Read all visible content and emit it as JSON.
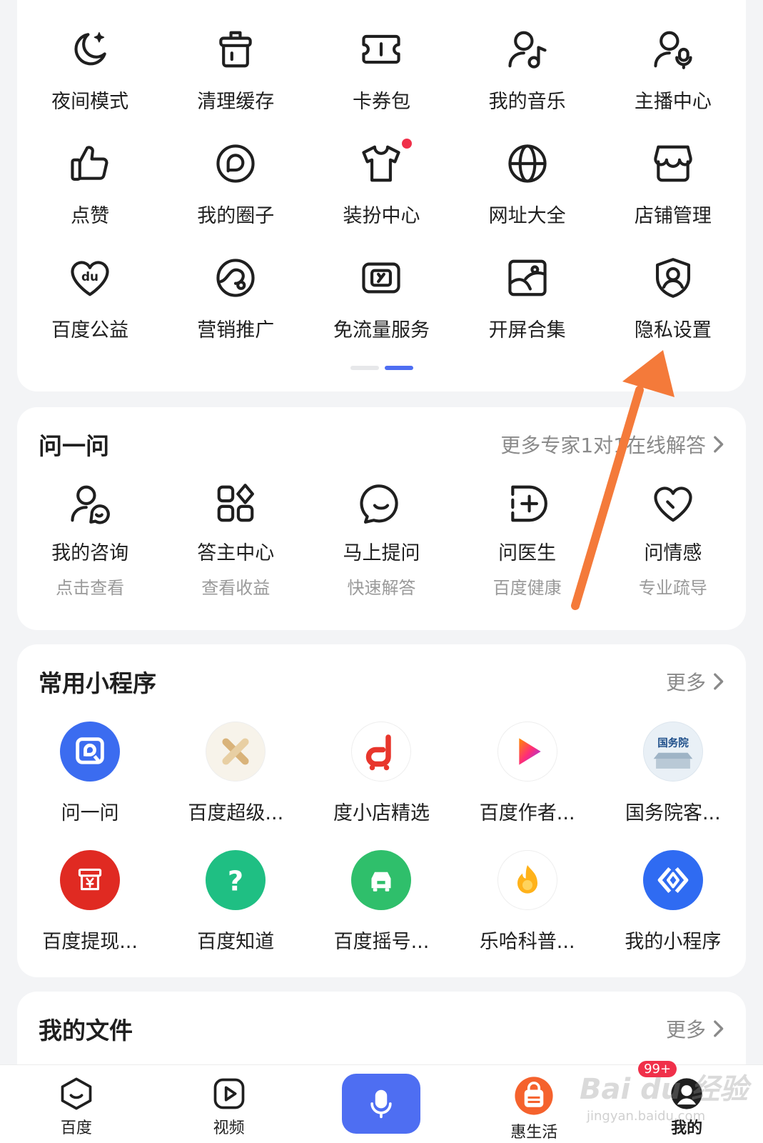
{
  "tools": {
    "rows": [
      [
        {
          "label": "夜间模式",
          "icon": "moon-icon"
        },
        {
          "label": "清理缓存",
          "icon": "trash-bin-icon"
        },
        {
          "label": "卡券包",
          "icon": "ticket-icon"
        },
        {
          "label": "我的音乐",
          "icon": "user-music-icon"
        },
        {
          "label": "主播中心",
          "icon": "user-mic-icon"
        }
      ],
      [
        {
          "label": "点赞",
          "icon": "thumbs-up-icon"
        },
        {
          "label": "我的圈子",
          "icon": "circle-ring-icon"
        },
        {
          "label": "装扮中心",
          "icon": "tshirt-icon"
        },
        {
          "label": "网址大全",
          "icon": "globe-icon"
        },
        {
          "label": "店铺管理",
          "icon": "shop-icon"
        }
      ],
      [
        {
          "label": "百度公益",
          "icon": "heart-du-icon"
        },
        {
          "label": "营销推广",
          "icon": "orbit-icon"
        },
        {
          "label": "免流量服务",
          "icon": "data-card-icon"
        },
        {
          "label": "开屏合集",
          "icon": "image-frame-icon"
        },
        {
          "label": "隐私设置",
          "icon": "shield-user-icon"
        }
      ]
    ]
  },
  "ask": {
    "title": "问一问",
    "more": "更多专家1对1在线解答",
    "items": [
      {
        "label": "我的咨询",
        "sub": "点击查看",
        "icon": "user-chat-icon"
      },
      {
        "label": "答主中心",
        "sub": "查看收益",
        "icon": "grid-apps-icon"
      },
      {
        "label": "马上提问",
        "sub": "快速解答",
        "icon": "chat-bubble-icon"
      },
      {
        "label": "问医生",
        "sub": "百度健康",
        "icon": "medical-plus-icon"
      },
      {
        "label": "问情感",
        "sub": "专业疏导",
        "icon": "heart-outline-icon"
      }
    ]
  },
  "mini": {
    "title": "常用小程序",
    "more": "更多",
    "rows": [
      [
        {
          "label": "问一问",
          "icon": "wenyiwen-app-icon",
          "color": "#3b6cf0"
        },
        {
          "label": "百度超级...",
          "icon": "baidu-super-app-icon",
          "color": "#f7f3ea"
        },
        {
          "label": "度小店精选",
          "icon": "duxiaodian-app-icon",
          "color": "#ffffff"
        },
        {
          "label": "百度作者...",
          "icon": "baidu-author-app-icon",
          "color": "#ffffff"
        },
        {
          "label": "国务院客...",
          "icon": "state-council-app-icon",
          "color": "#e9f0f6"
        }
      ],
      [
        {
          "label": "百度提现...",
          "icon": "baidu-cashout-app-icon",
          "color": "#e02a22"
        },
        {
          "label": "百度知道",
          "icon": "baidu-zhidao-app-icon",
          "color": "#1fbf83"
        },
        {
          "label": "百度摇号...",
          "icon": "baidu-lottery-car-app-icon",
          "color": "#2fbf6b"
        },
        {
          "label": "乐哈科普...",
          "icon": "leha-science-app-icon",
          "color": "#ffffff"
        },
        {
          "label": "我的小程序",
          "icon": "my-miniapp-icon",
          "color": "#2f6bf2"
        }
      ]
    ]
  },
  "files": {
    "title": "我的文件",
    "more": "更多"
  },
  "tabbar": {
    "items": [
      {
        "label": "百度",
        "icon": "baidu-home-icon"
      },
      {
        "label": "视频",
        "icon": "video-play-icon"
      },
      {
        "label": "",
        "icon": "microphone-icon"
      },
      {
        "label": "惠生活",
        "icon": "shopping-bag-icon"
      },
      {
        "label": "我的",
        "icon": "profile-avatar-icon",
        "badge": "99+"
      }
    ]
  },
  "watermark": {
    "text": "Bai du 经验",
    "sub": "jingyan.baidu.com"
  },
  "colors": {
    "accent": "#4e6ef2",
    "annotation_arrow": "#f47a3a",
    "red_dot": "#f0304a"
  }
}
